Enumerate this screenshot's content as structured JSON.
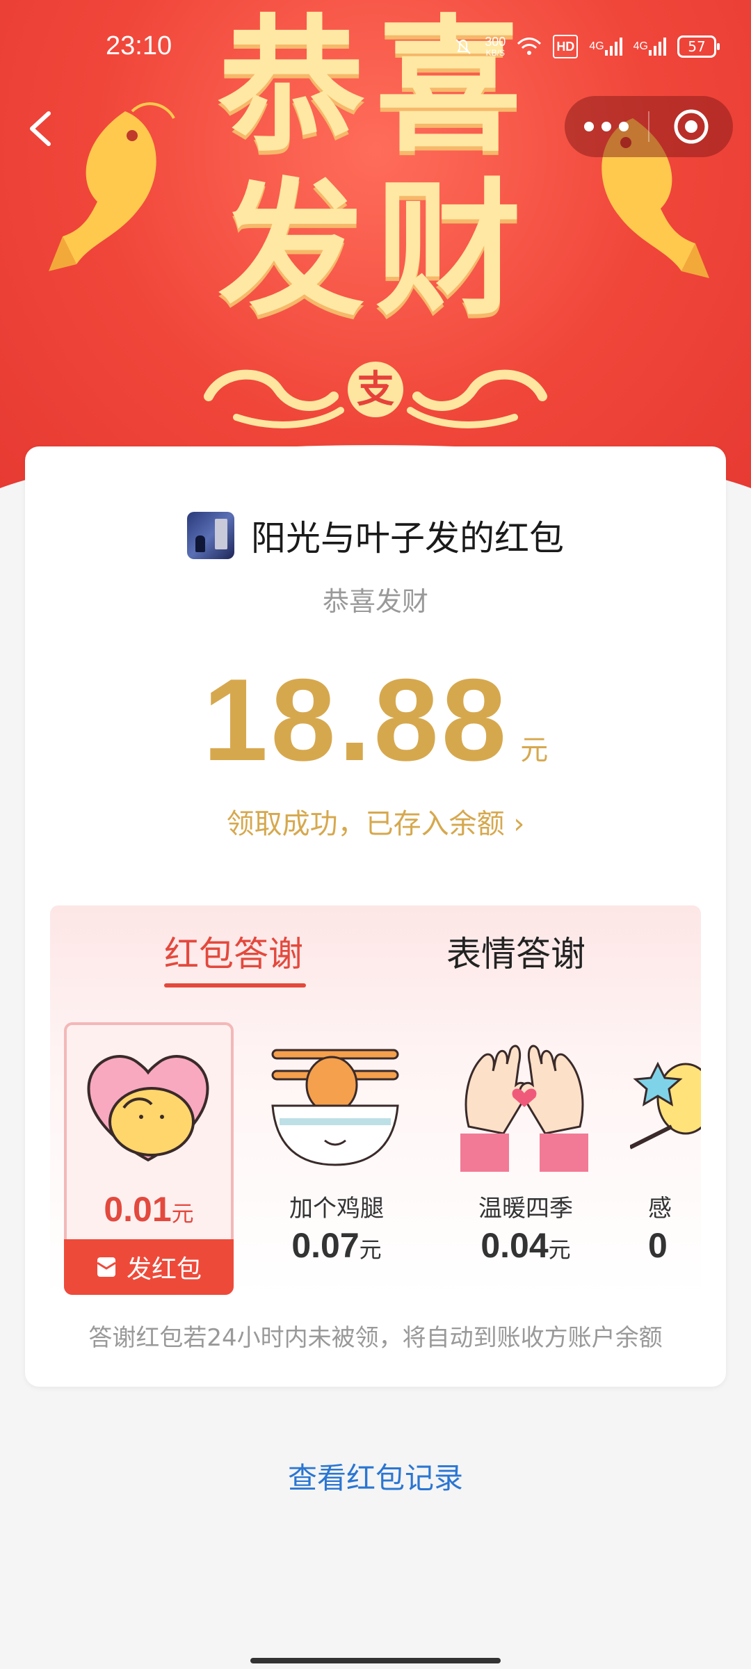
{
  "status_bar": {
    "time": "23:10",
    "speed_value": "300",
    "speed_unit": "KB/S",
    "hd_label": "HD",
    "net1": "4G",
    "net2": "4G",
    "battery": "57"
  },
  "hero": {
    "title_line1": "恭喜",
    "title_line2": "发财",
    "coin_glyph": "支"
  },
  "card": {
    "sender_text": "阳光与叶子发的红包",
    "blessing": "恭喜发财",
    "amount": "18.88",
    "unit": "元",
    "status_text": "领取成功，已存入余额",
    "status_chevron": "›",
    "hint": "答谢红包若24小时内未被领，将自动到账收方账户余额"
  },
  "thanks": {
    "tab_active": "红包答谢",
    "tab_inactive": "表情答谢",
    "send_label": "发红包",
    "items": [
      {
        "name": "",
        "price": "0.01",
        "unit": "元"
      },
      {
        "name": "加个鸡腿",
        "price": "0.07",
        "unit": "元"
      },
      {
        "name": "温暖四季",
        "price": "0.04",
        "unit": "元"
      },
      {
        "name": "感",
        "price": "0",
        "unit": ""
      }
    ]
  },
  "footer": {
    "records_link": "查看红包记录"
  },
  "colors": {
    "brand_red": "#e3493d",
    "gold": "#d6a84e",
    "link_blue": "#2a76d2"
  }
}
